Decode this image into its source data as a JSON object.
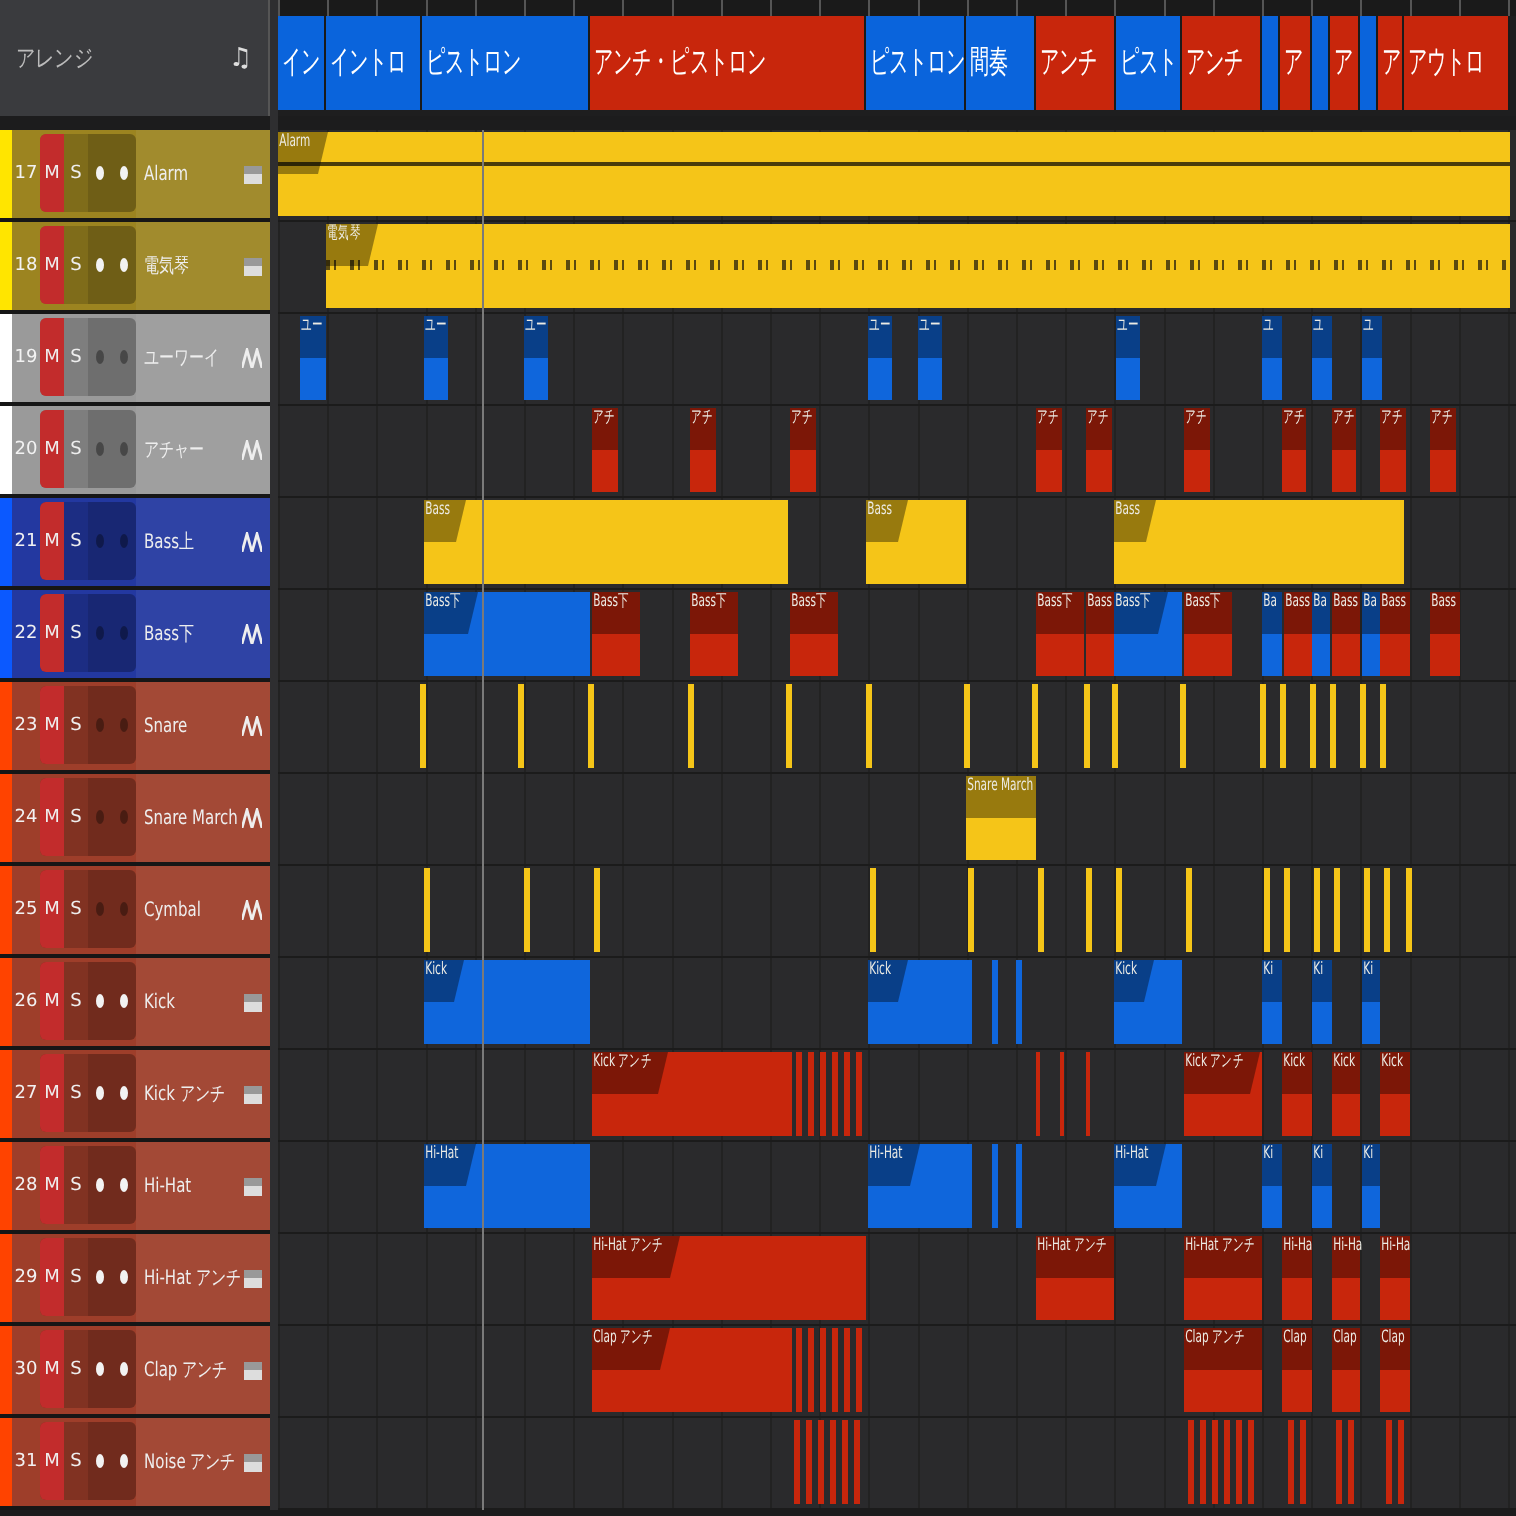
{
  "panel": {
    "title": "アレンジ",
    "icon": "♫"
  },
  "sections": [
    {
      "label": "イン",
      "color": "#0a64dc"
    },
    {
      "label": "イントロ",
      "color": "#0a64dc"
    },
    {
      "label": "ピストロン",
      "color": "#0a64dc"
    },
    {
      "label": "アンチ・ピストロン",
      "color": "#c8260c"
    },
    {
      "label": "ピストロン",
      "color": "#0a64dc"
    },
    {
      "label": "間奏",
      "color": "#0a64dc"
    },
    {
      "label": "アンチ",
      "color": "#c8260c"
    },
    {
      "label": "ピスト",
      "color": "#0a64dc"
    },
    {
      "label": "アンチ",
      "color": "#c8260c"
    },
    {
      "color": "#0a64dc"
    },
    {
      "label": "ア",
      "color": "#c8260c"
    },
    {
      "color": "#0a64dc"
    },
    {
      "label": "ア",
      "color": "#c8260c"
    },
    {
      "color": "#0a64dc"
    },
    {
      "label": "ア",
      "color": "#c8260c"
    },
    {
      "label": "アウトロ",
      "color": "#c8260c"
    }
  ],
  "tracks": [
    {
      "number": "17",
      "mute_label": "M",
      "solo_label": "S",
      "name": "Alarm",
      "color": "#9c8420",
      "kind": "instrument",
      "muted": true,
      "solo": false,
      "clips": [
        {
          "kind": "line_clip",
          "label": "Alarm",
          "color": "#f5c518"
        }
      ]
    },
    {
      "number": "18",
      "mute_label": "M",
      "solo_label": "S",
      "name": "電気琴",
      "color": "#9c8420",
      "kind": "instrument",
      "muted": true,
      "solo": false,
      "clips": [
        {
          "kind": "wave_clip",
          "label": "電気琴",
          "color": "#f5c518"
        }
      ]
    },
    {
      "number": "19",
      "mute_label": "M",
      "solo_label": "S",
      "name": "ユーワーイ",
      "color": "#9a9a9a",
      "kind": "audio",
      "muted": true,
      "solo": false,
      "clips": [
        {
          "kind": "clip",
          "label": "ユー",
          "color": "#0f66dc"
        },
        {
          "kind": "clip",
          "label": "ユー",
          "color": "#0f66dc"
        },
        {
          "kind": "clip",
          "label": "ユー",
          "color": "#0f66dc"
        },
        {
          "kind": "clip",
          "label": "ユー",
          "color": "#0f66dc"
        },
        {
          "kind": "clip",
          "label": "ユー",
          "color": "#0f66dc"
        },
        {
          "kind": "clip",
          "label": "ユー",
          "color": "#0f66dc"
        },
        {
          "kind": "clip",
          "label": "ユ",
          "color": "#0f66dc"
        },
        {
          "kind": "clip",
          "label": "ユ",
          "color": "#0f66dc"
        },
        {
          "kind": "clip",
          "label": "ユ",
          "color": "#0f66dc"
        }
      ]
    },
    {
      "number": "20",
      "mute_label": "M",
      "solo_label": "S",
      "name": "アチャー",
      "color": "#9a9a9a",
      "kind": "audio",
      "muted": true,
      "solo": false,
      "clips": [
        {
          "kind": "clip",
          "label": "アチ",
          "color": "#c8260c"
        },
        {
          "kind": "clip",
          "label": "アチ",
          "color": "#c8260c"
        },
        {
          "kind": "clip",
          "label": "アチ",
          "color": "#c8260c"
        },
        {
          "kind": "clip",
          "label": "アチ",
          "color": "#c8260c"
        },
        {
          "kind": "clip",
          "label": "アチ",
          "color": "#c8260c"
        },
        {
          "kind": "clip",
          "label": "アチ",
          "color": "#c8260c"
        },
        {
          "kind": "clip",
          "label": "アチ",
          "color": "#c8260c"
        },
        {
          "kind": "clip",
          "label": "アチ",
          "color": "#c8260c"
        },
        {
          "kind": "clip",
          "label": "アチ",
          "color": "#c8260c"
        },
        {
          "kind": "clip",
          "label": "アチ",
          "color": "#c8260c"
        }
      ]
    },
    {
      "number": "21",
      "mute_label": "M",
      "solo_label": "S",
      "name": "Bass上",
      "color": "#2338a0",
      "kind": "audio",
      "muted": true,
      "solo": false,
      "clips": [
        {
          "kind": "clip",
          "label": "Bass",
          "color": "#f5c518"
        },
        {
          "kind": "clip",
          "label": "Bass",
          "color": "#f5c518"
        },
        {
          "kind": "clip",
          "label": "Bass",
          "color": "#f5c518"
        }
      ]
    },
    {
      "number": "22",
      "mute_label": "M",
      "solo_label": "S",
      "name": "Bass下",
      "color": "#2338a0",
      "kind": "audio",
      "muted": true,
      "solo": false,
      "clips": [
        {
          "kind": "clip",
          "label": "Bass下",
          "color": "#0f66dc"
        },
        {
          "kind": "clip",
          "label": "Bass下",
          "color": "#c8260c"
        },
        {
          "kind": "clip",
          "label": "Bass下",
          "color": "#c8260c"
        },
        {
          "kind": "clip",
          "label": "Bass下",
          "color": "#c8260c"
        },
        {
          "kind": "clip",
          "label": "Bass下",
          "color": "#c8260c"
        },
        {
          "kind": "clip",
          "label": "Bass",
          "color": "#c8260c"
        },
        {
          "kind": "clip",
          "label": "Bass下",
          "color": "#0f66dc"
        },
        {
          "kind": "clip",
          "label": "Bass下",
          "color": "#c8260c"
        },
        {
          "kind": "clip",
          "label": "Ba",
          "color": "#0f66dc"
        },
        {
          "kind": "clip",
          "label": "Bass",
          "color": "#c8260c"
        },
        {
          "kind": "clip",
          "label": "Ba",
          "color": "#0f66dc"
        },
        {
          "kind": "clip",
          "label": "Bass",
          "color": "#c8260c"
        },
        {
          "kind": "clip",
          "label": "Ba",
          "color": "#0f66dc"
        },
        {
          "kind": "clip",
          "label": "Bass",
          "color": "#c8260c"
        },
        {
          "kind": "clip",
          "label": "Bass",
          "color": "#c8260c"
        }
      ]
    },
    {
      "number": "23",
      "mute_label": "M",
      "solo_label": "S",
      "name": "Snare",
      "color": "#9e3e2a",
      "kind": "audio",
      "muted": true,
      "solo": false,
      "clips": [
        {
          "kind": "hit",
          "color": "#f5c518"
        },
        {
          "kind": "hit",
          "color": "#f5c518"
        },
        {
          "kind": "hit",
          "color": "#f5c518"
        },
        {
          "kind": "hit",
          "color": "#f5c518"
        },
        {
          "kind": "hit",
          "color": "#f5c518"
        },
        {
          "kind": "hit",
          "color": "#f5c518"
        },
        {
          "kind": "hit",
          "color": "#f5c518"
        },
        {
          "kind": "hit",
          "color": "#f5c518"
        },
        {
          "kind": "hit",
          "color": "#f5c518"
        },
        {
          "kind": "hit",
          "color": "#f5c518"
        },
        {
          "kind": "hit",
          "color": "#f5c518"
        },
        {
          "kind": "hit",
          "color": "#f5c518"
        },
        {
          "kind": "hit",
          "color": "#f5c518"
        },
        {
          "kind": "hit",
          "color": "#f5c518"
        },
        {
          "kind": "hit",
          "color": "#f5c518"
        },
        {
          "kind": "hit",
          "color": "#f5c518"
        },
        {
          "kind": "hit",
          "color": "#f5c518"
        }
      ]
    },
    {
      "number": "24",
      "mute_label": "M",
      "solo_label": "S",
      "name": "Snare March",
      "color": "#9e3e2a",
      "kind": "audio",
      "muted": true,
      "solo": false,
      "clips": [
        {
          "kind": "clip",
          "label": "Snare March",
          "color": "#f5c518"
        }
      ]
    },
    {
      "number": "25",
      "mute_label": "M",
      "solo_label": "S",
      "name": "Cymbal",
      "color": "#9e3e2a",
      "kind": "audio",
      "muted": true,
      "solo": false,
      "clips": [
        {
          "kind": "hit",
          "color": "#f5c518"
        },
        {
          "kind": "hit",
          "color": "#f5c518"
        },
        {
          "kind": "hit",
          "color": "#f5c518"
        },
        {
          "kind": "hit",
          "color": "#f5c518"
        },
        {
          "kind": "hit",
          "color": "#f5c518"
        },
        {
          "kind": "hit",
          "color": "#f5c518"
        },
        {
          "kind": "hit",
          "color": "#f5c518"
        },
        {
          "kind": "hit",
          "color": "#f5c518"
        },
        {
          "kind": "hit",
          "color": "#f5c518"
        },
        {
          "kind": "hit",
          "color": "#f5c518"
        },
        {
          "kind": "hit",
          "color": "#f5c518"
        },
        {
          "kind": "hit",
          "color": "#f5c518"
        },
        {
          "kind": "hit",
          "color": "#f5c518"
        },
        {
          "kind": "hit",
          "color": "#f5c518"
        },
        {
          "kind": "hit",
          "color": "#f5c518"
        },
        {
          "kind": "hit",
          "color": "#f5c518"
        }
      ]
    },
    {
      "number": "26",
      "mute_label": "M",
      "solo_label": "S",
      "name": "Kick",
      "color": "#9e3e2a",
      "kind": "instrument",
      "muted": true,
      "solo": false,
      "clips": [
        {
          "kind": "clip",
          "label": "Kick",
          "color": "#0f66dc"
        },
        {
          "kind": "clip",
          "label": "Kick",
          "color": "#0f66dc"
        },
        {
          "kind": "hit",
          "color": "#0f66dc"
        },
        {
          "kind": "hit",
          "color": "#0f66dc"
        },
        {
          "kind": "clip",
          "label": "Kick",
          "color": "#0f66dc"
        },
        {
          "kind": "clip",
          "label": "Ki",
          "color": "#0f66dc"
        },
        {
          "kind": "clip",
          "label": "Ki",
          "color": "#0f66dc"
        },
        {
          "kind": "clip",
          "label": "Ki",
          "color": "#0f66dc"
        }
      ]
    },
    {
      "number": "27",
      "mute_label": "M",
      "solo_label": "S",
      "name": "Kick アンチ",
      "color": "#9e3e2a",
      "kind": "instrument",
      "muted": true,
      "solo": false,
      "clips": [
        {
          "kind": "clip",
          "label": "Kick アンチ",
          "color": "#c8260c"
        },
        {
          "kind": "stripes",
          "color": "#c8260c"
        },
        {
          "kind": "hit",
          "color": "#c8260c"
        },
        {
          "kind": "hit",
          "color": "#c8260c"
        },
        {
          "kind": "hit",
          "color": "#c8260c"
        },
        {
          "kind": "clip",
          "label": "Kick アンチ",
          "color": "#c8260c"
        },
        {
          "kind": "clip",
          "label": "Kick",
          "color": "#c8260c"
        },
        {
          "kind": "clip",
          "label": "Kick",
          "color": "#c8260c"
        },
        {
          "kind": "clip",
          "label": "Kick",
          "color": "#c8260c"
        }
      ]
    },
    {
      "number": "28",
      "mute_label": "M",
      "solo_label": "S",
      "name": "Hi-Hat",
      "color": "#9e3e2a",
      "kind": "instrument",
      "muted": true,
      "solo": false,
      "clips": [
        {
          "kind": "clip",
          "label": "Hi-Hat",
          "color": "#0f66dc"
        },
        {
          "kind": "clip",
          "label": "Hi-Hat",
          "color": "#0f66dc"
        },
        {
          "kind": "hit",
          "color": "#0f66dc"
        },
        {
          "kind": "hit",
          "color": "#0f66dc"
        },
        {
          "kind": "clip",
          "label": "Hi-Hat",
          "color": "#0f66dc"
        },
        {
          "kind": "clip",
          "label": "Ki",
          "color": "#0f66dc"
        },
        {
          "kind": "clip",
          "label": "Ki",
          "color": "#0f66dc"
        },
        {
          "kind": "clip",
          "label": "Ki",
          "color": "#0f66dc"
        }
      ]
    },
    {
      "number": "29",
      "mute_label": "M",
      "solo_label": "S",
      "name": "Hi-Hat アンチ",
      "color": "#9e3e2a",
      "kind": "instrument",
      "muted": true,
      "solo": false,
      "clips": [
        {
          "kind": "clip",
          "label": "Hi-Hat アンチ",
          "color": "#c8260c"
        },
        {
          "kind": "clip",
          "label": "Hi-Hat アンチ",
          "color": "#c8260c"
        },
        {
          "kind": "clip",
          "label": "Hi-Hat アンチ",
          "color": "#c8260c"
        },
        {
          "kind": "clip",
          "label": "Hi-Ha",
          "color": "#c8260c"
        },
        {
          "kind": "clip",
          "label": "Hi-Ha",
          "color": "#c8260c"
        },
        {
          "kind": "clip",
          "label": "Hi-Ha",
          "color": "#c8260c"
        }
      ]
    },
    {
      "number": "30",
      "mute_label": "M",
      "solo_label": "S",
      "name": "Clap アンチ",
      "color": "#9e3e2a",
      "kind": "instrument",
      "muted": true,
      "solo": false,
      "clips": [
        {
          "kind": "clip",
          "label": "Clap アンチ",
          "color": "#c8260c"
        },
        {
          "kind": "stripes",
          "color": "#c8260c"
        },
        {
          "kind": "clip",
          "label": "Clap アンチ",
          "color": "#c8260c"
        },
        {
          "kind": "clip",
          "label": "Clap",
          "color": "#c8260c"
        },
        {
          "kind": "clip",
          "label": "Clap",
          "color": "#c8260c"
        },
        {
          "kind": "clip",
          "label": "Clap",
          "color": "#c8260c"
        }
      ]
    },
    {
      "number": "31",
      "mute_label": "M",
      "solo_label": "S",
      "name": "Noise アンチ",
      "color": "#9e3e2a",
      "kind": "instrument",
      "muted": true,
      "solo": false,
      "clips": [
        {
          "kind": "stripes",
          "color": "#c8260c"
        },
        {
          "kind": "stripes",
          "color": "#c8260c"
        },
        {
          "kind": "stripes",
          "color": "#c8260c"
        },
        {
          "kind": "stripes",
          "color": "#c8260c"
        },
        {
          "kind": "stripes",
          "color": "#c8260c"
        }
      ]
    }
  ]
}
